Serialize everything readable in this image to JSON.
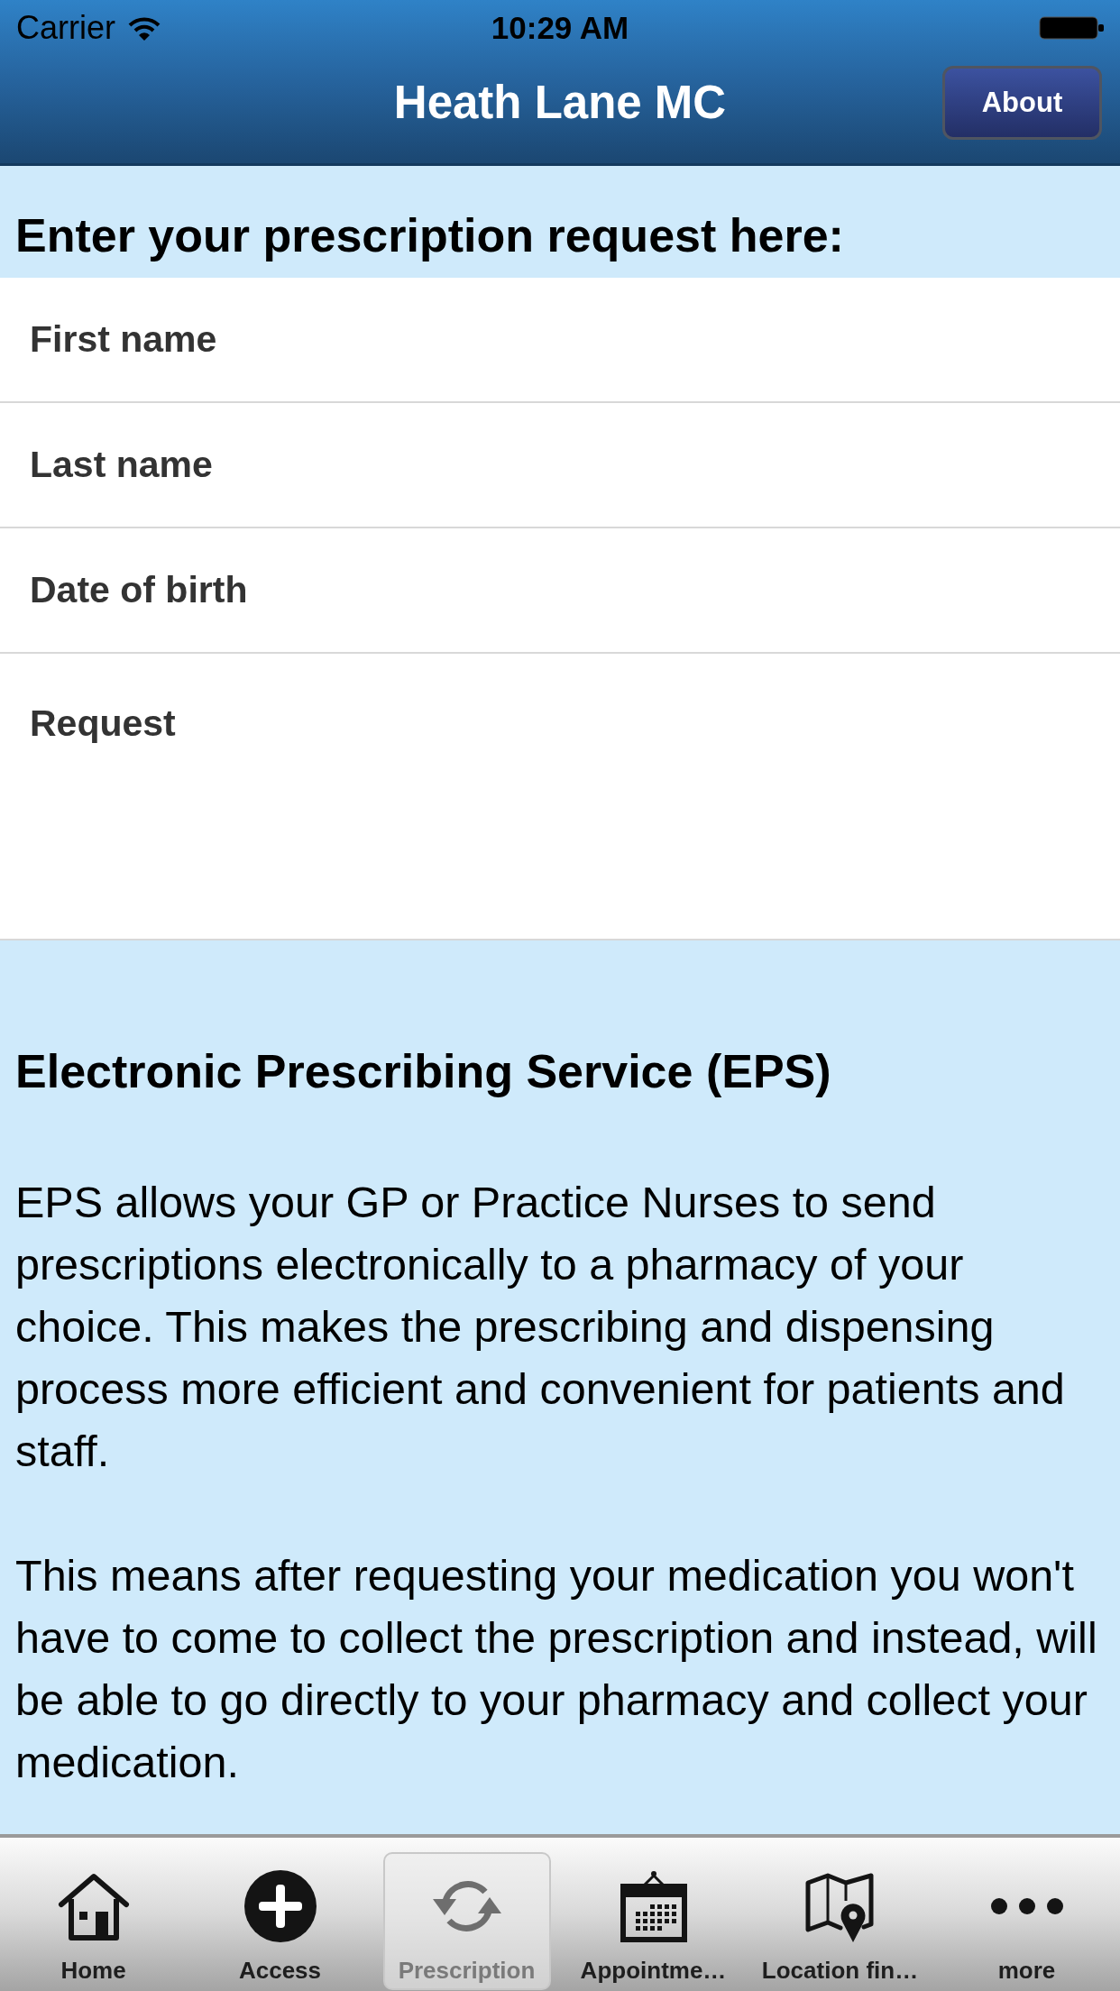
{
  "status_bar": {
    "carrier": "Carrier",
    "time": "10:29 AM"
  },
  "nav_bar": {
    "title": "Heath Lane MC",
    "button": "About"
  },
  "form": {
    "heading": "Enter your prescription request here:",
    "fields": [
      {
        "kind": "line",
        "placeholder": "First name"
      },
      {
        "kind": "line",
        "placeholder": "Last name"
      },
      {
        "kind": "line",
        "placeholder": "Date of birth"
      },
      {
        "kind": "multiline",
        "placeholder": "Request"
      }
    ]
  },
  "info": {
    "title": "Electronic Prescribing Service (EPS)",
    "paragraphs": [
      "EPS allows your GP or Practice Nurses to send prescriptions electronically to a pharmacy of your choice. This makes the prescribing and dispensing process more efficient and convenient for patients and staff.",
      "This means after requesting your medication you won't have to come to collect the prescription and instead, will be able to go directly to your pharmacy and collect your medication."
    ]
  },
  "tab_bar": {
    "tabs": [
      {
        "label": "Home",
        "selected": false
      },
      {
        "label": "Access",
        "selected": false
      },
      {
        "label": "Prescription",
        "selected": true
      },
      {
        "label": "Appointme…",
        "selected": false
      },
      {
        "label": "Location fin…",
        "selected": false
      },
      {
        "label": "more",
        "selected": false
      }
    ]
  }
}
